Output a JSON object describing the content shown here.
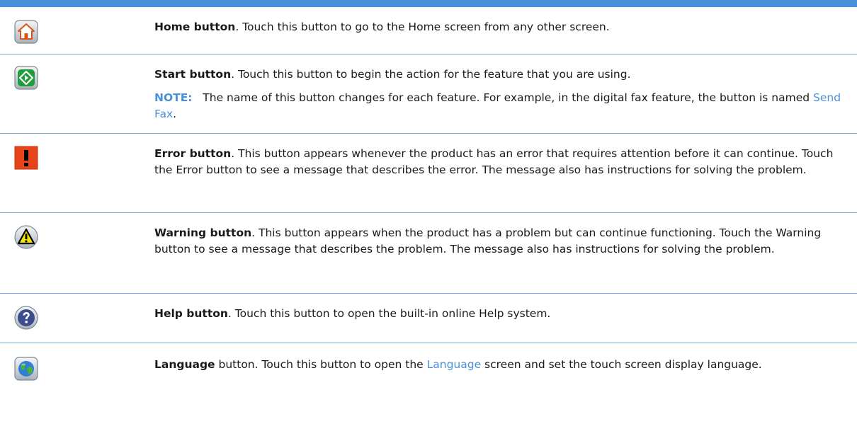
{
  "rows": [
    {
      "icon": "home-icon",
      "title": "Home button",
      "text": ". Touch this button to go to the Home screen from any other screen."
    },
    {
      "icon": "start-icon",
      "title": "Start button",
      "text": ". Touch this button to begin the action for the feature that you are using.",
      "note_label": "NOTE:",
      "note_text": "   The name of this button changes for each feature. For example, in the digital fax feature, the button is named ",
      "note_link": "Send Fax",
      "note_end": "."
    },
    {
      "icon": "error-icon",
      "title": "Error button",
      "text": ". This button appears whenever the product has an error that requires attention before it can continue. Touch the Error button to see a message that describes the error. The message also has instructions for solving the problem."
    },
    {
      "icon": "warning-icon",
      "title": "Warning button",
      "text": ". This button appears when the product has a problem but can continue functioning. Touch the Warning button to see a message that describes the problem. The message also has instructions for solving the problem."
    },
    {
      "icon": "help-icon",
      "title": "Help button",
      "text": ". Touch this button to open the built-in online Help system."
    },
    {
      "icon": "language-icon",
      "title": "Language",
      "text_before": " button. Touch this button to open the ",
      "link": "Language",
      "text_after": " screen and set the touch screen display language."
    }
  ],
  "colors": {
    "accent": "#4a90d9",
    "divider": "#6fa8dc",
    "error": "#e8441a",
    "warning": "#f2e600"
  }
}
